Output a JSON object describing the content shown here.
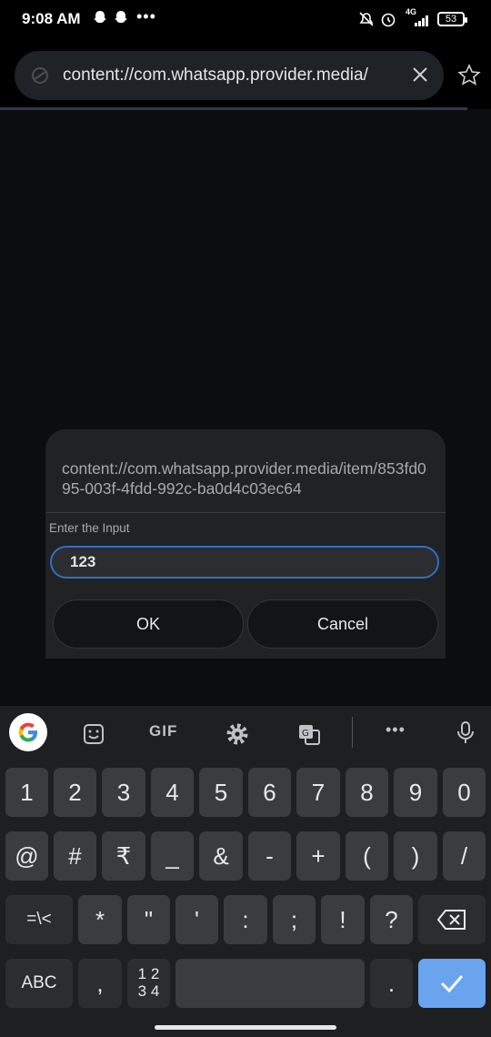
{
  "status": {
    "time": "9:08 AM",
    "network": "4G",
    "battery": "53"
  },
  "browser": {
    "url": "content://com.whatsapp.provider.media/"
  },
  "dialog": {
    "message": "content://com.whatsapp.provider.media/item/853fd095-003f-4fdd-992c-ba0d4c03ec64",
    "input_label": "Enter the Input",
    "input_value": "123",
    "ok_label": "OK",
    "cancel_label": "Cancel"
  },
  "keyboard": {
    "toolbar": {
      "gif_label": "GIF"
    },
    "row1": [
      "1",
      "2",
      "3",
      "4",
      "5",
      "6",
      "7",
      "8",
      "9",
      "0"
    ],
    "row2": [
      "@",
      "#",
      "₹",
      "_",
      "&",
      "-",
      "+",
      "(",
      ")",
      "/"
    ],
    "row3": [
      "=\\<",
      "*",
      "\"",
      "'",
      ":",
      ";",
      "!",
      "?"
    ],
    "abc_label": "ABC",
    "comma_label": ",",
    "numpad_label_top": "1 2",
    "numpad_label_bottom": "3 4",
    "period_label": "."
  }
}
